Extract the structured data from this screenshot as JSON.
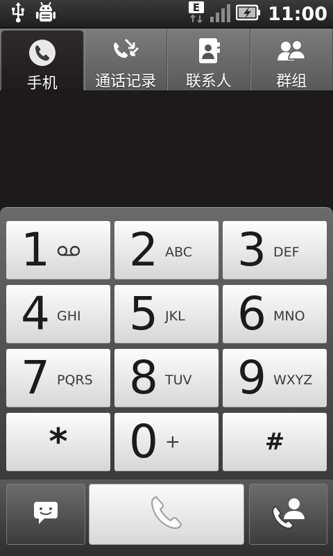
{
  "status_bar": {
    "time": "11:00",
    "left_icons": [
      "usb-icon",
      "debug-icon"
    ],
    "right_icons": [
      "edge-network-icon",
      "signal-icon",
      "battery-charging-icon"
    ],
    "network_letter": "E"
  },
  "tabs": [
    {
      "label": "手机",
      "icon": "phone-icon",
      "active": true
    },
    {
      "label": "通话记录",
      "icon": "call-log-icon",
      "active": false
    },
    {
      "label": "联系人",
      "icon": "contacts-icon",
      "active": false
    },
    {
      "label": "群组",
      "icon": "groups-icon",
      "active": false
    }
  ],
  "keypad": [
    {
      "digit": "1",
      "letters": "",
      "icon": "voicemail-icon"
    },
    {
      "digit": "2",
      "letters": "ABC"
    },
    {
      "digit": "3",
      "letters": "DEF"
    },
    {
      "digit": "4",
      "letters": "GHI"
    },
    {
      "digit": "5",
      "letters": "JKL"
    },
    {
      "digit": "6",
      "letters": "MNO"
    },
    {
      "digit": "7",
      "letters": "PQRS"
    },
    {
      "digit": "8",
      "letters": "TUV"
    },
    {
      "digit": "9",
      "letters": "WXYZ"
    },
    {
      "digit": "*",
      "letters": ""
    },
    {
      "digit": "0",
      "letters": "+"
    },
    {
      "digit": "#",
      "letters": ""
    }
  ],
  "actions": [
    {
      "name": "sms-button",
      "icon": "message-icon"
    },
    {
      "name": "call-button",
      "icon": "phone-handset-icon"
    },
    {
      "name": "add-contact-button",
      "icon": "add-call-contact-icon"
    }
  ],
  "colors": {
    "background": "#1d1a1b",
    "key_face": "#f0f0f0",
    "tab_bar": "#6a6a6a",
    "text_dark": "#1b1b1b"
  }
}
